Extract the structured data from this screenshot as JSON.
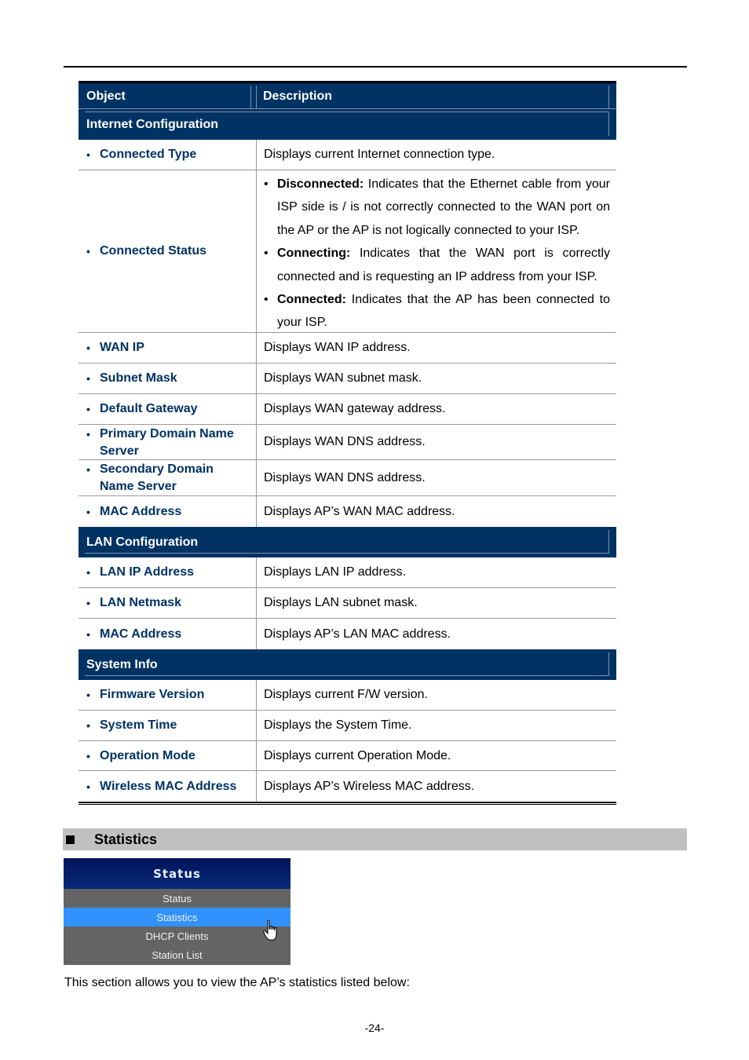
{
  "table": {
    "header": {
      "object": "Object",
      "description": "Description"
    },
    "sections": [
      {
        "title": "Internet Configuration",
        "rows": [
          {
            "object": "Connected Type",
            "description": "Displays current Internet connection type."
          },
          {
            "object": "Connected Status",
            "items": [
              {
                "term": "Disconnected:",
                "text": " Indicates that the Ethernet cable from your ISP side is / is not correctly connected to the WAN port on the AP or the AP is not logically connected to your ISP."
              },
              {
                "term": "Connecting:",
                "text": " Indicates that the WAN port is correctly connected and is requesting an IP address from your ISP."
              },
              {
                "term": "Connected:",
                "text": " Indicates that the AP has been connected to your ISP."
              }
            ]
          },
          {
            "object": "WAN IP",
            "description": "Displays WAN IP address."
          },
          {
            "object": "Subnet Mask",
            "description": "Displays WAN subnet mask."
          },
          {
            "object": "Default Gateway",
            "description": "Displays WAN gateway address."
          },
          {
            "object": "Primary Domain Name Server",
            "object_line1": "Primary Domain Name",
            "object_line2": "Server",
            "description": "Displays WAN DNS address."
          },
          {
            "object": "Secondary Domain Name Server",
            "object_line1": "Secondary Domain",
            "object_line2": "Name Server",
            "description": "Displays WAN DNS address."
          },
          {
            "object": "MAC Address",
            "description": "Displays AP’s WAN MAC address."
          }
        ]
      },
      {
        "title": "LAN Configuration",
        "rows": [
          {
            "object": "LAN IP Address",
            "description": "Displays LAN IP address."
          },
          {
            "object": "LAN Netmask",
            "description": "Displays LAN subnet mask."
          },
          {
            "object": "MAC Address",
            "description": "Displays AP’s LAN MAC address."
          }
        ]
      },
      {
        "title": "System Info",
        "rows": [
          {
            "object": "Firmware Version",
            "description": "Displays current F/W version."
          },
          {
            "object": "System Time",
            "description": "Displays the System Time."
          },
          {
            "object": "Operation Mode",
            "description": "Displays current Operation Mode."
          },
          {
            "object": "Wireless MAC Address",
            "description": "Displays AP’s Wireless MAC address."
          }
        ]
      }
    ]
  },
  "statistics_heading": "Statistics",
  "menu": {
    "title": "Status",
    "items": [
      "Status",
      "Statistics",
      "DHCP Clients",
      "Station List"
    ],
    "active_index": 1
  },
  "paragraph": "This section allows you to view the AP’s statistics listed below:",
  "page_number": "-24-",
  "colors": {
    "header_bg": "#003264",
    "object_text": "#003264",
    "menu_active": "#3192fe",
    "menu_bg": "#646464",
    "section_bar": "#c0c0c0"
  }
}
